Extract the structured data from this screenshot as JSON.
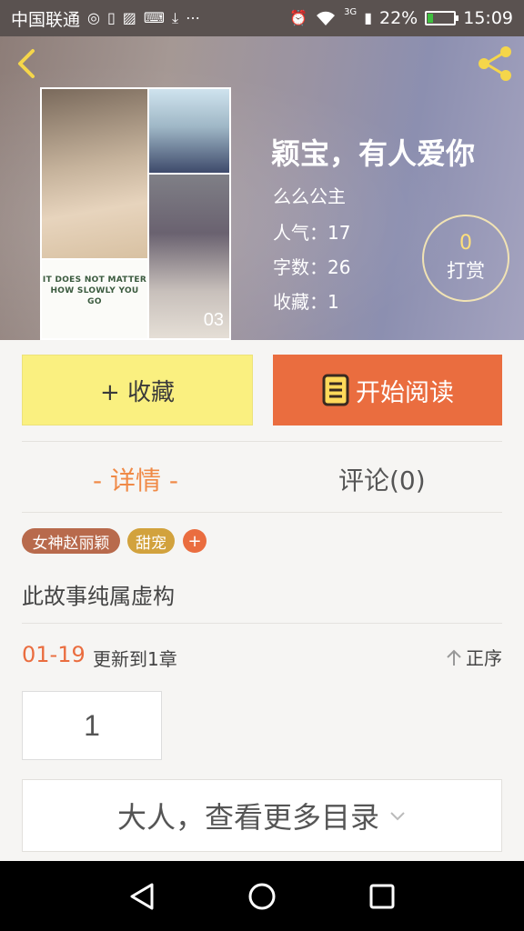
{
  "status_bar": {
    "carrier": "中国联通",
    "battery": "22%",
    "battery_level": 0.22,
    "time": "15:09",
    "network": "3G",
    "icons": [
      "notification-icon",
      "sim-icon",
      "image-icon",
      "keyboard-icon",
      "download-icon",
      "more-icon",
      "alarm-icon",
      "wifi-icon",
      "signal-icon",
      "battery-charging-icon"
    ]
  },
  "header": {
    "cover_quote": "IT DOES NOT MATTER HOW SLOWLY YOU GO",
    "cover_number": "03",
    "title": "颖宝，有人爱你",
    "author": "么么公主",
    "popularity": "人气：17",
    "word_count": "字数：26",
    "favorites": "收藏：1",
    "tip_count": "0",
    "tip_label": "打赏"
  },
  "actions": {
    "favorite": "+ 收藏",
    "read": "开始阅读"
  },
  "tabs": {
    "detail": "- 详情 -",
    "comments": "评论(0)"
  },
  "tags": [
    "女神赵丽颖",
    "甜宠"
  ],
  "tag_add": "+",
  "description": "此故事纯属虚构",
  "update": {
    "date": "01-19",
    "text": "更新到1章",
    "sort": "正序"
  },
  "chapter": "1",
  "more_catalog": "大人，查看更多目录",
  "colors": {
    "accent": "#ea6d3f",
    "favorite_bg": "#faf080",
    "tag_1": "#b86a4c",
    "tag_2": "#d2a23d"
  }
}
